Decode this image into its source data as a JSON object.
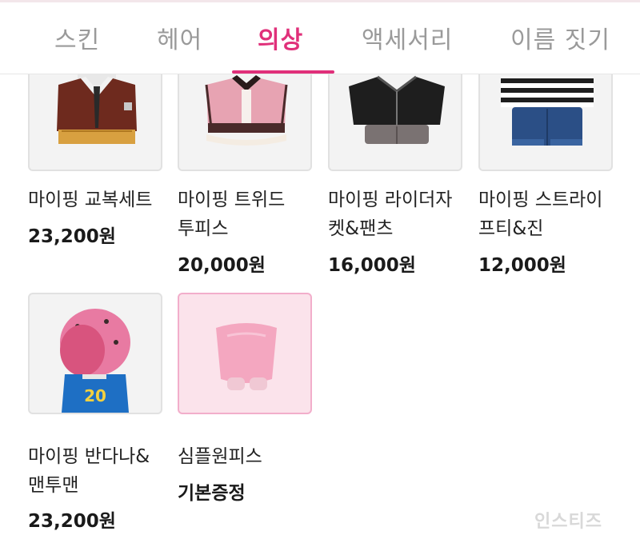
{
  "tabs": [
    {
      "label": "스킨"
    },
    {
      "label": "헤어"
    },
    {
      "label": "의상"
    },
    {
      "label": "액세서리"
    },
    {
      "label": "이름 짓기"
    }
  ],
  "active_tab": "의상",
  "items": [
    {
      "name_line1": "마이핑 교복세트",
      "name_line2": "",
      "price": "23,200원",
      "icon": "school-uniform-outfit"
    },
    {
      "name_line1": "마이핑 트위드",
      "name_line2": "투피스",
      "price": "20,000원",
      "icon": "tweed-two-piece-outfit"
    },
    {
      "name_line1": "마이핑 라이더자",
      "name_line2": "켓&팬츠",
      "price": "16,000원",
      "icon": "rider-jacket-pants-outfit"
    },
    {
      "name_line1": "마이핑 스트라이",
      "name_line2": "프티&진",
      "price": "12,000원",
      "icon": "striped-tee-jeans-outfit"
    },
    {
      "name_line1": "마이핑 반다나&",
      "name_line2": "맨투맨",
      "price": "23,200원",
      "icon": "bandana-sweatshirt-outfit",
      "jersey_number": "20"
    },
    {
      "name_line1": "심플원피스",
      "name_line2": "",
      "price": "기본증정",
      "icon": "simple-pink-dress",
      "selected": true
    }
  ],
  "watermark": "인스티즈",
  "colors": {
    "accent": "#e0307a",
    "tab_inactive": "#9a9a9a",
    "selected_bg": "#fbe3eb",
    "selected_border": "#f2aecb"
  }
}
